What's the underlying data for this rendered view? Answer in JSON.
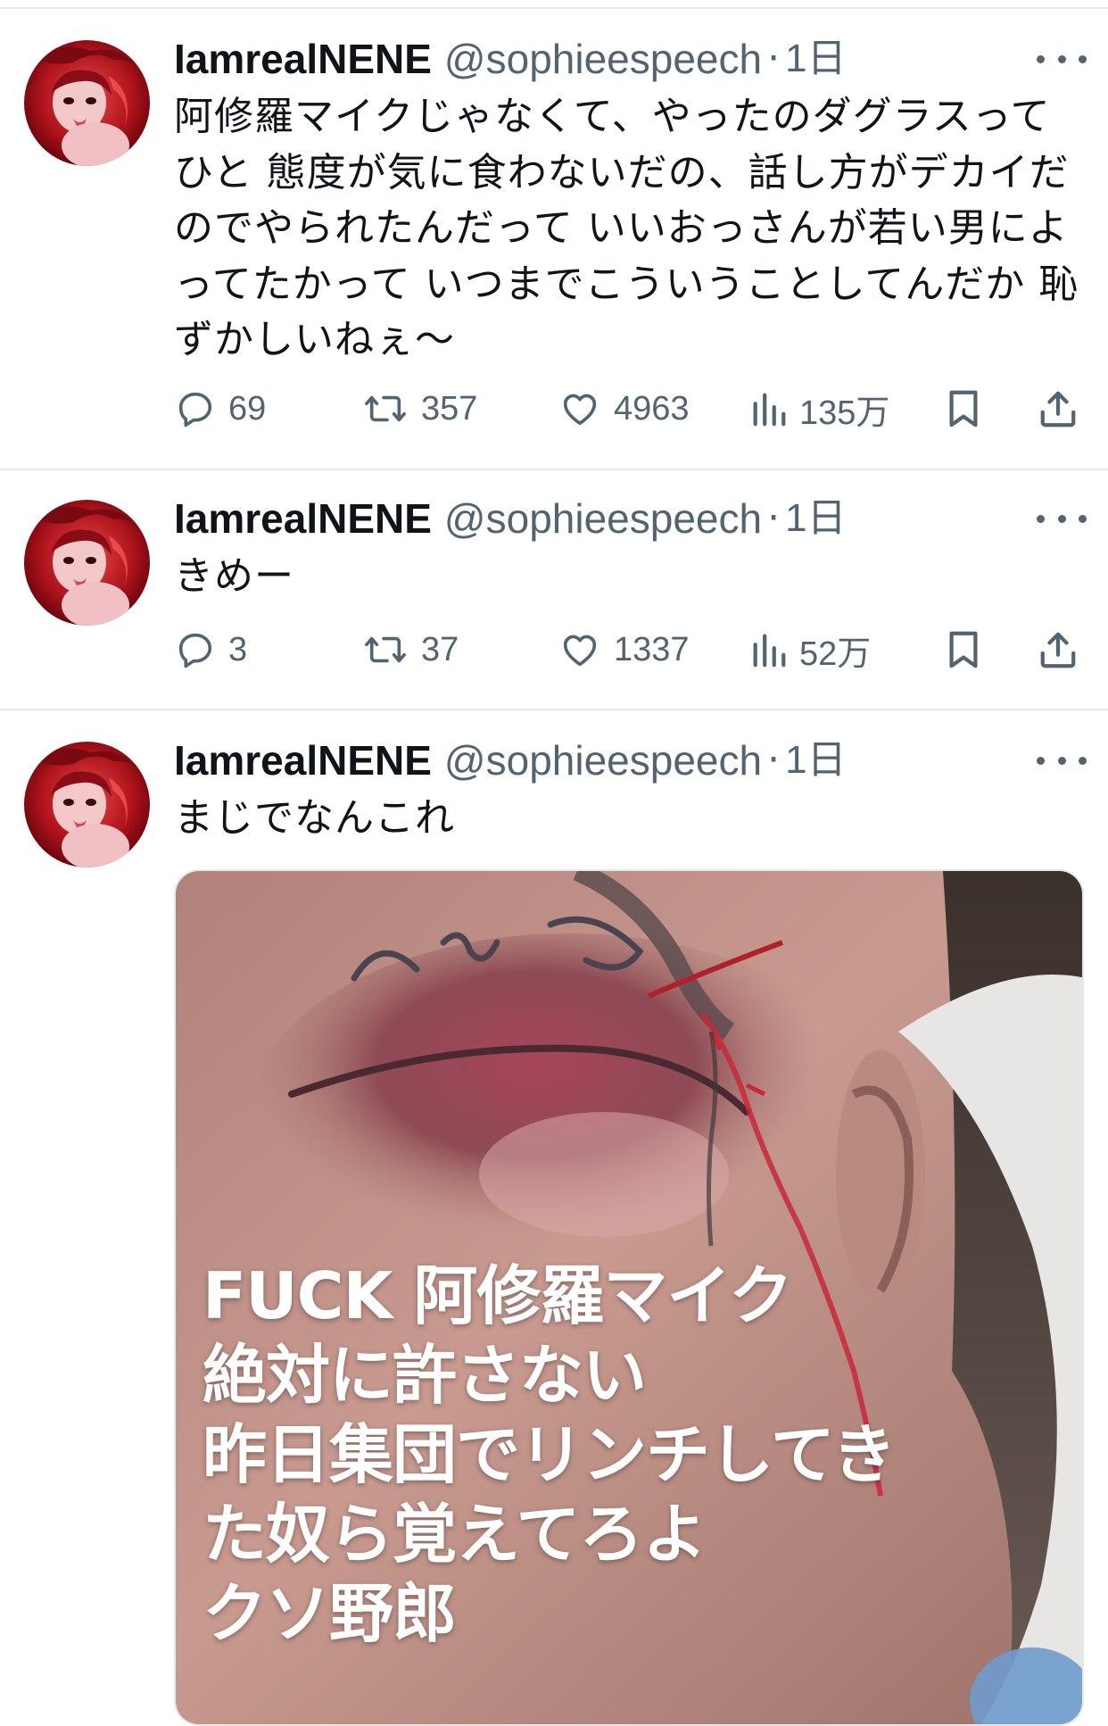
{
  "colors": {
    "text": "#0f1419",
    "secondary": "#536471",
    "border": "#e6e9ec"
  },
  "tweets": [
    {
      "name": "IamrealNENE",
      "handle": "@sophieespeech",
      "separator": "·",
      "time": "1日",
      "text": "阿修羅マイクじゃなくて、やったのダグラスって\nひと 態度が気に食わないだの、話し方がデカイだ\nのでやられたんだって いいおっさんが若い男によ\nってたかって いつまでこういうことしてんだか 恥\nずかしいねぇ〜",
      "replies": "69",
      "retweets": "357",
      "likes": "4963",
      "views": "135万"
    },
    {
      "name": "IamrealNENE",
      "handle": "@sophieespeech",
      "separator": "·",
      "time": "1日",
      "text": "きめー",
      "replies": "3",
      "retweets": "37",
      "likes": "1337",
      "views": "52万"
    },
    {
      "name": "IamrealNENE",
      "handle": "@sophieespeech",
      "separator": "·",
      "time": "1日",
      "text": "まじでなんこれ",
      "media_caption": "FUCK 阿修羅マイク\n絶対に許さない\n昨日集団でリンチしてき\nた奴ら覚えてろよ\nクソ野郎"
    }
  ],
  "icons": {
    "reply": "reply-icon",
    "retweet": "retweet-icon",
    "like": "heart-icon",
    "views": "views-icon",
    "bookmark": "bookmark-icon",
    "share": "share-icon",
    "more": "more-icon"
  }
}
